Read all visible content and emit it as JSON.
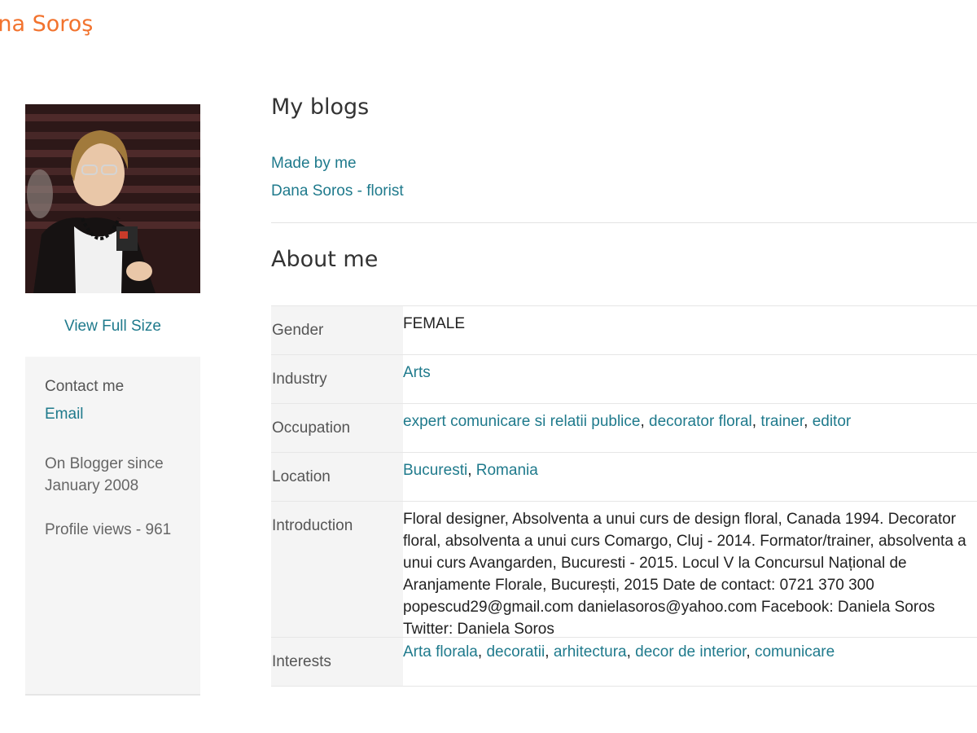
{
  "site": {
    "title": "Dana Soroş"
  },
  "profile": {
    "view_full_size": "View Full Size",
    "contact_title": "Contact me",
    "email_label": "Email",
    "since": "On Blogger since January 2008",
    "views": "Profile views - 961"
  },
  "blogs": {
    "title": "My blogs",
    "items": [
      "Made by me",
      "Dana Soros - florist"
    ]
  },
  "about": {
    "title": "About me",
    "rows": [
      {
        "label": "Gender",
        "value": "FEMALE"
      },
      {
        "label": "Industry",
        "value": "Arts"
      },
      {
        "label": "Occupation",
        "links": [
          "expert comunicare si relatii publice",
          "decorator floral",
          "trainer",
          "editor"
        ]
      },
      {
        "label": "Location",
        "links": [
          "Bucuresti",
          "Romania"
        ]
      },
      {
        "label": "Introduction",
        "value": "Floral designer, Absolventa a unui curs de design floral, Canada 1994. Decorator floral, absolventa a unui curs Comargo, Cluj - 2014. Formator/trainer, absolventa a unui curs Avangarden, Bucuresti - 2015. Locul V la Concursul Național de Aranjamente Florale, București, 2015 Date de contact: 0721 370 300 popescud29@gmail.com danielasoros@yahoo.com Facebook: Daniela Soros Twitter: Daniela Soros"
      },
      {
        "label": "Interests",
        "links": [
          "Arta florala",
          "decoratii",
          "arhitectura",
          "decor de interior",
          "comunicare"
        ]
      }
    ]
  },
  "colors": {
    "accent_orange": "#f2732e",
    "link_teal": "#1f7a8c"
  }
}
